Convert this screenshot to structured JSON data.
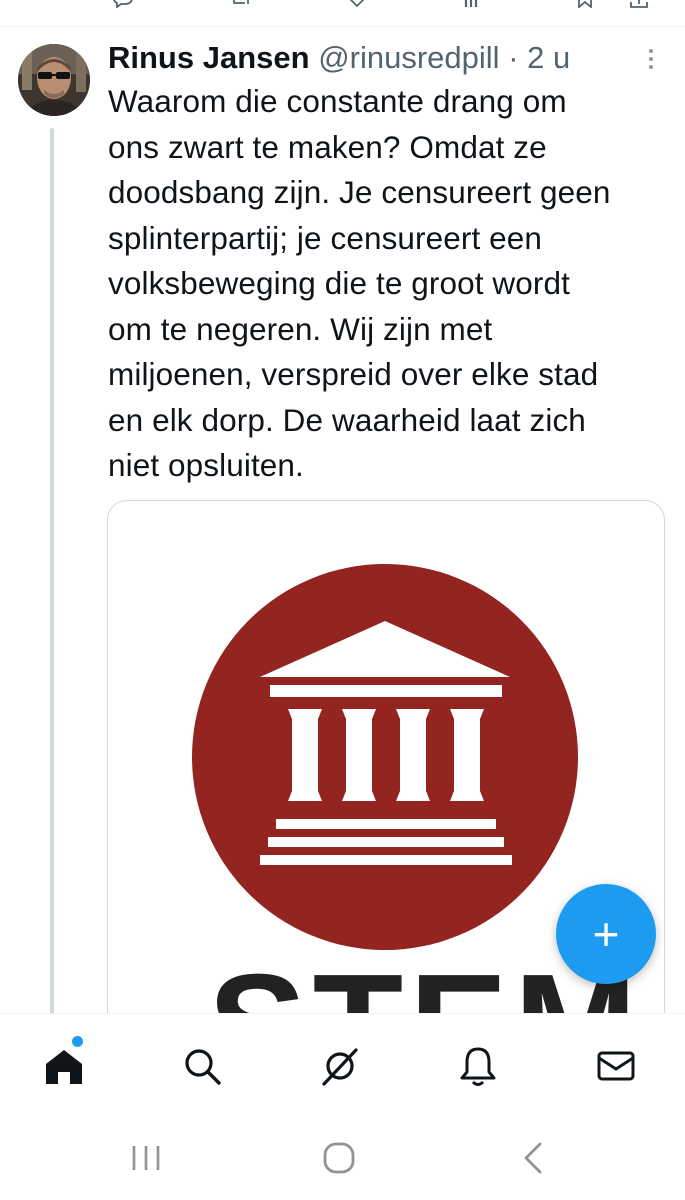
{
  "tweet": {
    "author": {
      "display_name": "Rinus Jansen",
      "handle": "@rinusredpill",
      "separator": "·",
      "time": "2 u",
      "avatar_icon": "avatar-photo"
    },
    "text_lines": [
      "Waarom die constante drang om",
      "ons zwart te maken? Omdat ze",
      "doodsbang zijn. Je censureert geen",
      "splinterpartij; je censureert een",
      "volksbeweging die te groot wordt",
      "om te negeren. Wij zijn met",
      "miljoenen, verspreid over elke stad",
      "en elk dorp. De waarheid laat zich",
      "niet opsluiten."
    ],
    "media": {
      "logo_icon": "courthouse-icon",
      "logo_color": "#932420",
      "logo_text": "STEM"
    },
    "more_icon": "more-vertical-icon"
  },
  "top_actions": {
    "icons": [
      "reply-icon",
      "repost-icon",
      "like-icon",
      "views-icon",
      "bookmark-icon",
      "share-icon"
    ]
  },
  "compose": {
    "label": "+",
    "icon": "plus-icon",
    "color": "#1d9bf0"
  },
  "bottom_nav": {
    "items": [
      {
        "icon": "home-icon",
        "active": true,
        "badge": true
      },
      {
        "icon": "search-icon"
      },
      {
        "icon": "grok-icon"
      },
      {
        "icon": "bell-icon"
      },
      {
        "icon": "mail-icon"
      }
    ]
  },
  "system_nav": {
    "items": [
      {
        "icon": "recent-apps-icon"
      },
      {
        "icon": "home-circle-icon"
      },
      {
        "icon": "back-icon"
      }
    ]
  },
  "colors": {
    "accent": "#1d9bf0",
    "text": "#0f1419",
    "secondary": "#536471"
  }
}
